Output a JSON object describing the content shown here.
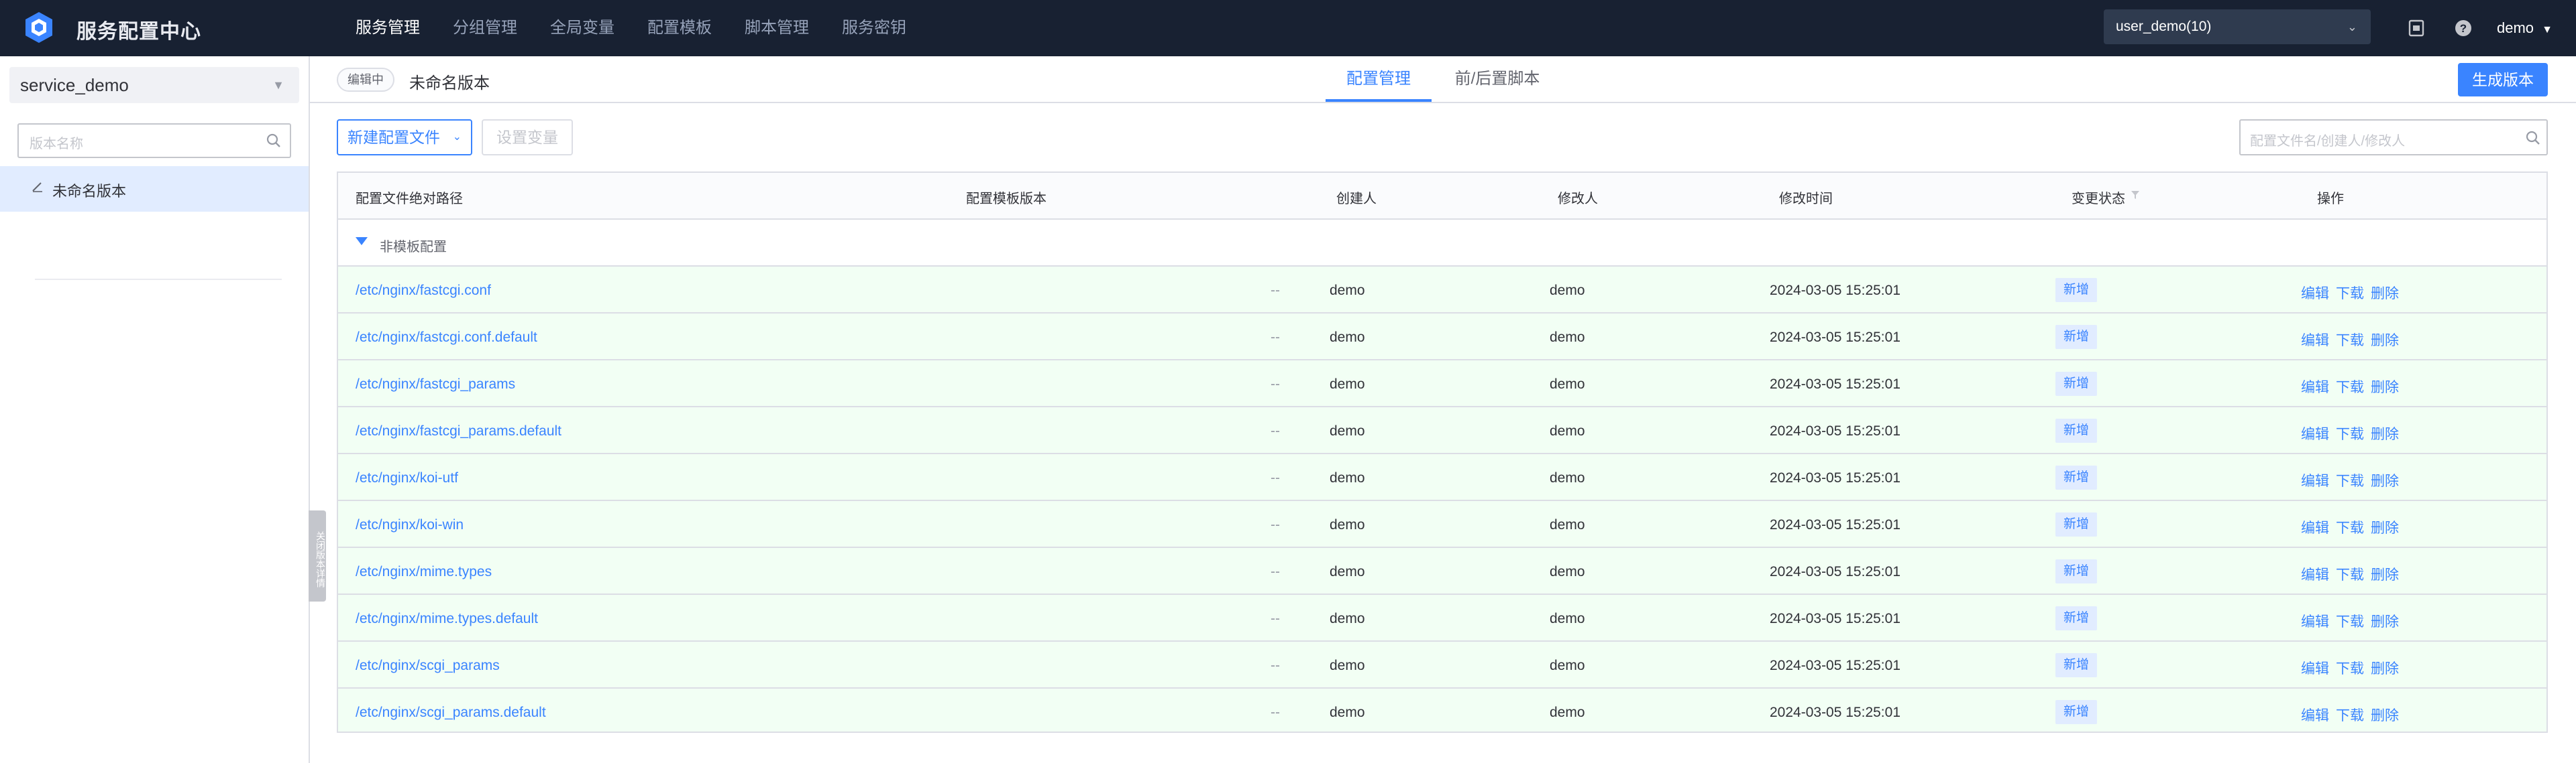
{
  "app": {
    "title": "服务配置中心"
  },
  "nav": {
    "items": [
      {
        "label": "服务管理",
        "active": true
      },
      {
        "label": "分组管理"
      },
      {
        "label": "全局变量"
      },
      {
        "label": "配置模板"
      },
      {
        "label": "脚本管理"
      },
      {
        "label": "服务密钥"
      }
    ]
  },
  "header": {
    "business_select": "user_demo(10)",
    "user": "demo",
    "icons": [
      "document-icon",
      "help-icon"
    ]
  },
  "sidebar": {
    "service_select": "service_demo",
    "search_placeholder": "版本名称",
    "versions": [
      {
        "label": "未命名版本",
        "icon": "edit-icon"
      }
    ],
    "collapse_label": "关闭版本详情"
  },
  "subbar": {
    "status_tag": "编辑中",
    "version_name": "未命名版本",
    "tabs": [
      {
        "label": "配置管理",
        "active": true
      },
      {
        "label": "前/后置脚本"
      }
    ],
    "generate_button": "生成版本"
  },
  "toolbar": {
    "new_button": "新建配置文件",
    "vars_button": "设置变量",
    "search_placeholder": "配置文件名/创建人/修改人"
  },
  "table": {
    "columns": [
      "配置文件绝对路径",
      "配置模板版本",
      "创建人",
      "修改人",
      "修改时间",
      "变更状态",
      "操作"
    ],
    "group_label": "非模板配置",
    "actions": [
      "编辑",
      "下载",
      "删除"
    ],
    "rows": [
      {
        "path": "/etc/nginx/fastcgi.conf",
        "template": "--",
        "creator": "demo",
        "modifier": "demo",
        "time": "2024-03-05 15:25:01",
        "status": "新增"
      },
      {
        "path": "/etc/nginx/fastcgi.conf.default",
        "template": "--",
        "creator": "demo",
        "modifier": "demo",
        "time": "2024-03-05 15:25:01",
        "status": "新增"
      },
      {
        "path": "/etc/nginx/fastcgi_params",
        "template": "--",
        "creator": "demo",
        "modifier": "demo",
        "time": "2024-03-05 15:25:01",
        "status": "新增"
      },
      {
        "path": "/etc/nginx/fastcgi_params.default",
        "template": "--",
        "creator": "demo",
        "modifier": "demo",
        "time": "2024-03-05 15:25:01",
        "status": "新增"
      },
      {
        "path": "/etc/nginx/koi-utf",
        "template": "--",
        "creator": "demo",
        "modifier": "demo",
        "time": "2024-03-05 15:25:01",
        "status": "新增"
      },
      {
        "path": "/etc/nginx/koi-win",
        "template": "--",
        "creator": "demo",
        "modifier": "demo",
        "time": "2024-03-05 15:25:01",
        "status": "新增"
      },
      {
        "path": "/etc/nginx/mime.types",
        "template": "--",
        "creator": "demo",
        "modifier": "demo",
        "time": "2024-03-05 15:25:01",
        "status": "新增"
      },
      {
        "path": "/etc/nginx/mime.types.default",
        "template": "--",
        "creator": "demo",
        "modifier": "demo",
        "time": "2024-03-05 15:25:01",
        "status": "新增"
      },
      {
        "path": "/etc/nginx/scgi_params",
        "template": "--",
        "creator": "demo",
        "modifier": "demo",
        "time": "2024-03-05 15:25:01",
        "status": "新增"
      },
      {
        "path": "/etc/nginx/scgi_params.default",
        "template": "--",
        "creator": "demo",
        "modifier": "demo",
        "time": "2024-03-05 15:25:01",
        "status": "新增"
      }
    ]
  },
  "colors": {
    "accent": "#3a84ff",
    "topbar": "#182132",
    "row_added": "#f2fff4"
  }
}
